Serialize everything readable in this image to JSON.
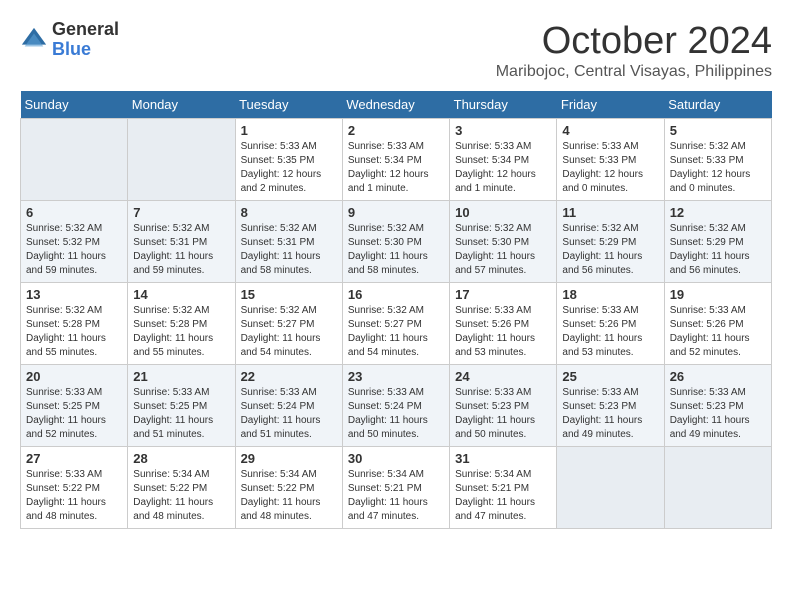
{
  "logo": {
    "general": "General",
    "blue": "Blue"
  },
  "header": {
    "month": "October 2024",
    "location": "Maribojoc, Central Visayas, Philippines"
  },
  "weekdays": [
    "Sunday",
    "Monday",
    "Tuesday",
    "Wednesday",
    "Thursday",
    "Friday",
    "Saturday"
  ],
  "weeks": [
    [
      {
        "day": "",
        "info": ""
      },
      {
        "day": "",
        "info": ""
      },
      {
        "day": "1",
        "info": "Sunrise: 5:33 AM\nSunset: 5:35 PM\nDaylight: 12 hours\nand 2 minutes."
      },
      {
        "day": "2",
        "info": "Sunrise: 5:33 AM\nSunset: 5:34 PM\nDaylight: 12 hours\nand 1 minute."
      },
      {
        "day": "3",
        "info": "Sunrise: 5:33 AM\nSunset: 5:34 PM\nDaylight: 12 hours\nand 1 minute."
      },
      {
        "day": "4",
        "info": "Sunrise: 5:33 AM\nSunset: 5:33 PM\nDaylight: 12 hours\nand 0 minutes."
      },
      {
        "day": "5",
        "info": "Sunrise: 5:32 AM\nSunset: 5:33 PM\nDaylight: 12 hours\nand 0 minutes."
      }
    ],
    [
      {
        "day": "6",
        "info": "Sunrise: 5:32 AM\nSunset: 5:32 PM\nDaylight: 11 hours\nand 59 minutes."
      },
      {
        "day": "7",
        "info": "Sunrise: 5:32 AM\nSunset: 5:31 PM\nDaylight: 11 hours\nand 59 minutes."
      },
      {
        "day": "8",
        "info": "Sunrise: 5:32 AM\nSunset: 5:31 PM\nDaylight: 11 hours\nand 58 minutes."
      },
      {
        "day": "9",
        "info": "Sunrise: 5:32 AM\nSunset: 5:30 PM\nDaylight: 11 hours\nand 58 minutes."
      },
      {
        "day": "10",
        "info": "Sunrise: 5:32 AM\nSunset: 5:30 PM\nDaylight: 11 hours\nand 57 minutes."
      },
      {
        "day": "11",
        "info": "Sunrise: 5:32 AM\nSunset: 5:29 PM\nDaylight: 11 hours\nand 56 minutes."
      },
      {
        "day": "12",
        "info": "Sunrise: 5:32 AM\nSunset: 5:29 PM\nDaylight: 11 hours\nand 56 minutes."
      }
    ],
    [
      {
        "day": "13",
        "info": "Sunrise: 5:32 AM\nSunset: 5:28 PM\nDaylight: 11 hours\nand 55 minutes."
      },
      {
        "day": "14",
        "info": "Sunrise: 5:32 AM\nSunset: 5:28 PM\nDaylight: 11 hours\nand 55 minutes."
      },
      {
        "day": "15",
        "info": "Sunrise: 5:32 AM\nSunset: 5:27 PM\nDaylight: 11 hours\nand 54 minutes."
      },
      {
        "day": "16",
        "info": "Sunrise: 5:32 AM\nSunset: 5:27 PM\nDaylight: 11 hours\nand 54 minutes."
      },
      {
        "day": "17",
        "info": "Sunrise: 5:33 AM\nSunset: 5:26 PM\nDaylight: 11 hours\nand 53 minutes."
      },
      {
        "day": "18",
        "info": "Sunrise: 5:33 AM\nSunset: 5:26 PM\nDaylight: 11 hours\nand 53 minutes."
      },
      {
        "day": "19",
        "info": "Sunrise: 5:33 AM\nSunset: 5:26 PM\nDaylight: 11 hours\nand 52 minutes."
      }
    ],
    [
      {
        "day": "20",
        "info": "Sunrise: 5:33 AM\nSunset: 5:25 PM\nDaylight: 11 hours\nand 52 minutes."
      },
      {
        "day": "21",
        "info": "Sunrise: 5:33 AM\nSunset: 5:25 PM\nDaylight: 11 hours\nand 51 minutes."
      },
      {
        "day": "22",
        "info": "Sunrise: 5:33 AM\nSunset: 5:24 PM\nDaylight: 11 hours\nand 51 minutes."
      },
      {
        "day": "23",
        "info": "Sunrise: 5:33 AM\nSunset: 5:24 PM\nDaylight: 11 hours\nand 50 minutes."
      },
      {
        "day": "24",
        "info": "Sunrise: 5:33 AM\nSunset: 5:23 PM\nDaylight: 11 hours\nand 50 minutes."
      },
      {
        "day": "25",
        "info": "Sunrise: 5:33 AM\nSunset: 5:23 PM\nDaylight: 11 hours\nand 49 minutes."
      },
      {
        "day": "26",
        "info": "Sunrise: 5:33 AM\nSunset: 5:23 PM\nDaylight: 11 hours\nand 49 minutes."
      }
    ],
    [
      {
        "day": "27",
        "info": "Sunrise: 5:33 AM\nSunset: 5:22 PM\nDaylight: 11 hours\nand 48 minutes."
      },
      {
        "day": "28",
        "info": "Sunrise: 5:34 AM\nSunset: 5:22 PM\nDaylight: 11 hours\nand 48 minutes."
      },
      {
        "day": "29",
        "info": "Sunrise: 5:34 AM\nSunset: 5:22 PM\nDaylight: 11 hours\nand 48 minutes."
      },
      {
        "day": "30",
        "info": "Sunrise: 5:34 AM\nSunset: 5:21 PM\nDaylight: 11 hours\nand 47 minutes."
      },
      {
        "day": "31",
        "info": "Sunrise: 5:34 AM\nSunset: 5:21 PM\nDaylight: 11 hours\nand 47 minutes."
      },
      {
        "day": "",
        "info": ""
      },
      {
        "day": "",
        "info": ""
      }
    ]
  ]
}
